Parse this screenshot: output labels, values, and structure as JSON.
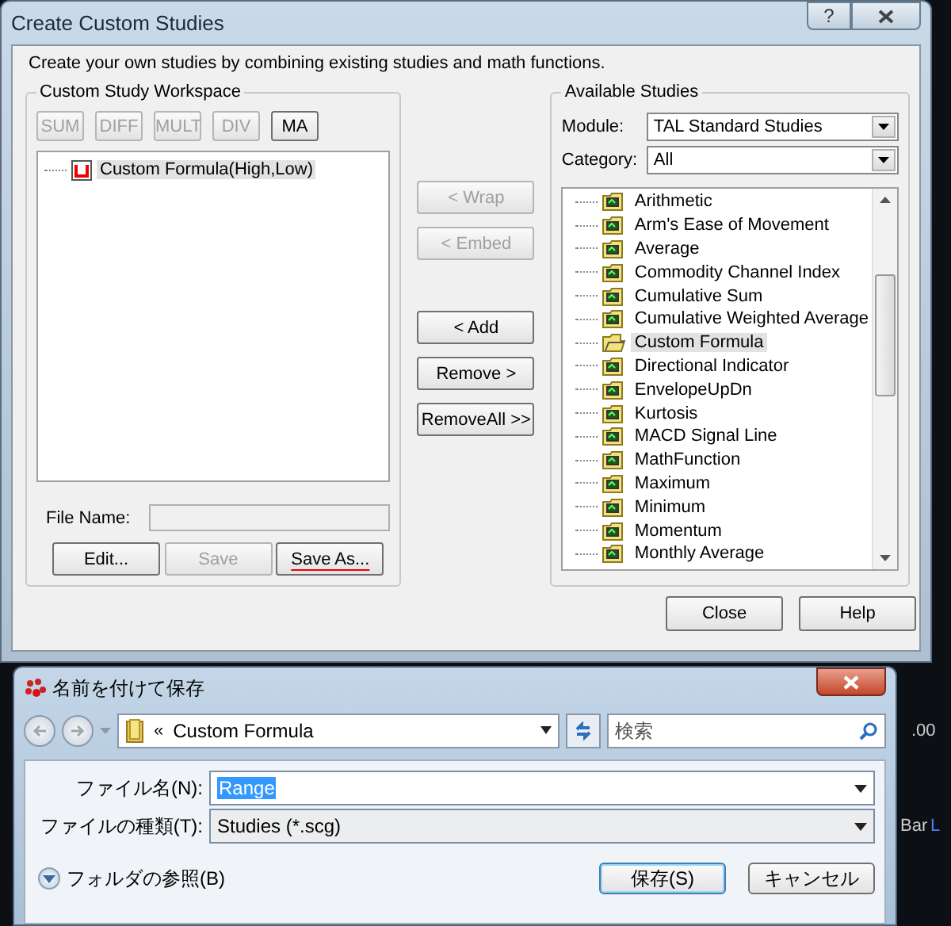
{
  "window": {
    "title": "Create Custom Studies",
    "help_glyph": "?",
    "intro": "Create your own studies by combining existing studies and math functions."
  },
  "workspace": {
    "title": "Custom Study Workspace",
    "operators": [
      {
        "label": "SUM",
        "disabled": true
      },
      {
        "label": "DIFF",
        "disabled": true
      },
      {
        "label": "MULT",
        "disabled": true
      },
      {
        "label": "DIV",
        "disabled": true
      },
      {
        "label": "MA",
        "disabled": false
      }
    ],
    "tree": [
      {
        "label": "Custom Formula(High,Low)",
        "selected": true
      }
    ],
    "file_name": {
      "label": "File Name:"
    },
    "buttons": [
      {
        "label": "Edit...",
        "disabled": false,
        "marked": false
      },
      {
        "label": "Save",
        "disabled": true,
        "marked": false
      },
      {
        "label": "Save As...",
        "disabled": false,
        "marked": true
      }
    ]
  },
  "actions": [
    {
      "label": "< Wrap",
      "disabled": true
    },
    {
      "label": "< Embed",
      "disabled": true
    },
    {
      "label": "< Add",
      "disabled": false
    },
    {
      "label": "Remove >",
      "disabled": false
    },
    {
      "label": "RemoveAll >>",
      "disabled": false
    }
  ],
  "available": {
    "title": "Available Studies",
    "module_label": "Module:",
    "module": "TAL Standard Studies",
    "category_label": "Category:",
    "category": "All",
    "studies": [
      {
        "label": "Arithmetic",
        "selected": false
      },
      {
        "label": "Arm's Ease of Movement",
        "selected": false
      },
      {
        "label": "Average",
        "selected": false
      },
      {
        "label": "Commodity Channel Index",
        "selected": false
      },
      {
        "label": "Cumulative Sum",
        "selected": false
      },
      {
        "label": "Cumulative Weighted Average",
        "selected": false
      },
      {
        "label": "Custom Formula",
        "selected": true
      },
      {
        "label": "Directional Indicator",
        "selected": false
      },
      {
        "label": "EnvelopeUpDn",
        "selected": false
      },
      {
        "label": "Kurtosis",
        "selected": false
      },
      {
        "label": "MACD Signal Line",
        "selected": false
      },
      {
        "label": "MathFunction",
        "selected": false
      },
      {
        "label": "Maximum",
        "selected": false
      },
      {
        "label": "Minimum",
        "selected": false
      },
      {
        "label": "Momentum",
        "selected": false
      },
      {
        "label": "Monthly Average",
        "selected": false
      }
    ]
  },
  "footer_buttons": [
    "Close",
    "Help"
  ],
  "save_dialog": {
    "title": "名前を付けて保存",
    "path_prefix": "«",
    "path": "Custom Formula",
    "search_placeholder": "検索",
    "file_name_label": "ファイル名(N):",
    "file_name": "Range",
    "file_type_label": "ファイルの種類(T):",
    "file_type": "Studies (*.scg)",
    "browse_folders": "フォルダの参照(B)",
    "expanded": false,
    "buttons": [
      "保存(S)",
      "キャンセル"
    ]
  },
  "background_texts": [
    ".00",
    "Bar",
    "L"
  ]
}
